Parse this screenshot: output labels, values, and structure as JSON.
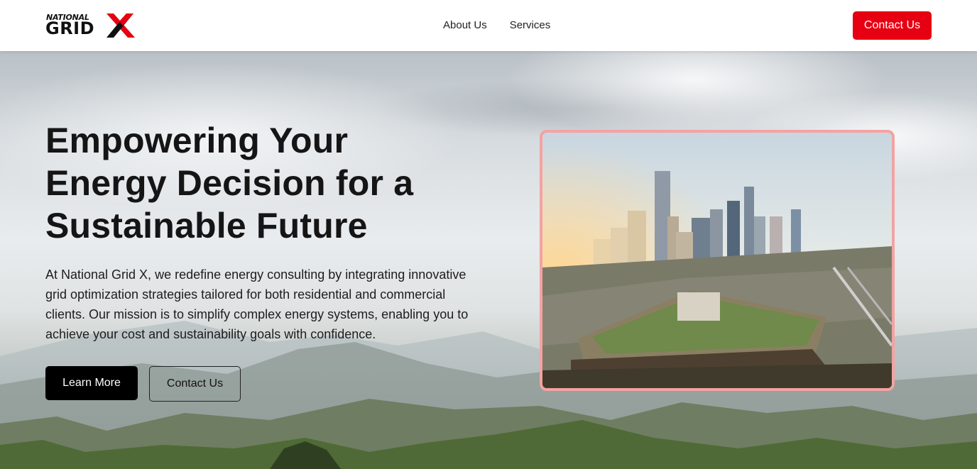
{
  "nav": {
    "logo_line1": "NATIONAL",
    "logo_line2": "GRID",
    "logo_mark": "X",
    "links": [
      {
        "label": "About Us"
      },
      {
        "label": "Services"
      }
    ],
    "cta_label": "Contact Us"
  },
  "hero": {
    "headline_line1": "Empowering Your",
    "headline_line2": "Energy Decision for a",
    "headline_line3": "Sustainable Future",
    "description": "At National Grid X, we redefine energy consulting by integrating innovative grid optimization strategies tailored for both residential and commercial clients. Our mission is to simplify complex energy systems, enabling you to achieve your cost and sustainability goals with confidence.",
    "primary_button": "Learn More",
    "secondary_button": "Contact Us",
    "image_border_color": "#f4a2a2"
  },
  "colors": {
    "brand_red": "#e60012",
    "primary_button_bg": "#000000"
  }
}
